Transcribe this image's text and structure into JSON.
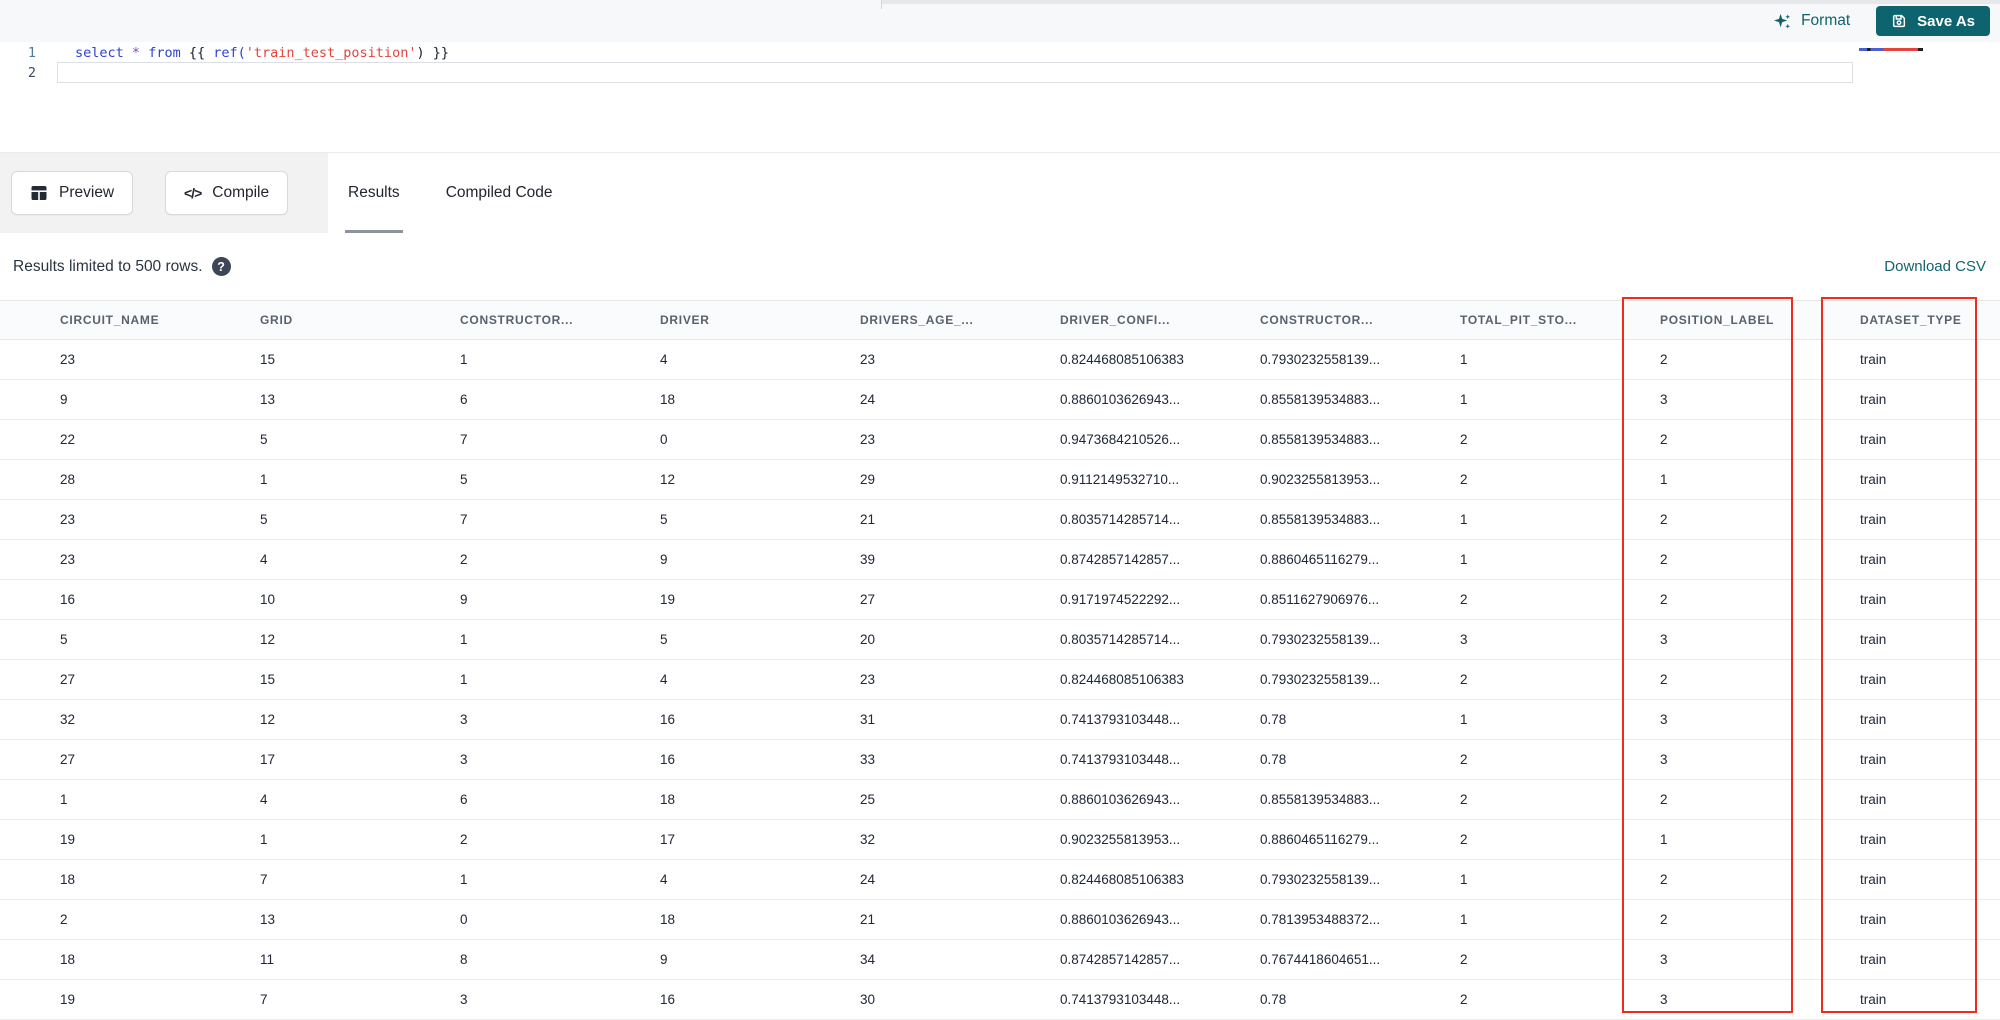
{
  "app": {
    "accent_teal": "#0e646e",
    "annotation_red": "#f02b1d"
  },
  "editor": {
    "format_label": "Format",
    "save_as_label": "Save As",
    "line_numbers": [
      "1",
      "2"
    ],
    "code_tokens": [
      {
        "t": "select",
        "c": "kw"
      },
      {
        "t": " ",
        "c": "pl"
      },
      {
        "t": "*",
        "c": "op"
      },
      {
        "t": " ",
        "c": "pl"
      },
      {
        "t": "from",
        "c": "kw"
      },
      {
        "t": " ",
        "c": "pl"
      },
      {
        "t": "{{ ",
        "c": "br"
      },
      {
        "t": "ref(",
        "c": "fn"
      },
      {
        "t": "'train_test_position'",
        "c": "str"
      },
      {
        "t": ")",
        "c": "br"
      },
      {
        "t": " }}",
        "c": "br"
      }
    ]
  },
  "toolbar": {
    "preview_label": "Preview",
    "compile_label": "Compile",
    "compile_glyph": "</>",
    "tabs": [
      {
        "label": "Results",
        "active": true
      },
      {
        "label": "Compiled Code",
        "active": false
      }
    ]
  },
  "results_bar": {
    "limit_text": "Results limited to 500 rows.",
    "help_glyph": "?",
    "download_label": "Download CSV"
  },
  "table": {
    "columns": [
      "CIRCUIT_NAME",
      "GRID",
      "CONSTRUCTOR...",
      "DRIVER",
      "DRIVERS_AGE_...",
      "DRIVER_CONFI...",
      "CONSTRUCTOR...",
      "TOTAL_PIT_STO...",
      "POSITION_LABEL",
      "DATASET_TYPE"
    ],
    "highlighted_columns": [
      "POSITION_LABEL",
      "DATASET_TYPE"
    ],
    "rows": [
      [
        "23",
        "15",
        "1",
        "4",
        "23",
        "0.824468085106383",
        "0.7930232558139...",
        "1",
        "2",
        "train"
      ],
      [
        "9",
        "13",
        "6",
        "18",
        "24",
        "0.8860103626943...",
        "0.8558139534883...",
        "1",
        "3",
        "train"
      ],
      [
        "22",
        "5",
        "7",
        "0",
        "23",
        "0.9473684210526...",
        "0.8558139534883...",
        "2",
        "2",
        "train"
      ],
      [
        "28",
        "1",
        "5",
        "12",
        "29",
        "0.9112149532710...",
        "0.9023255813953...",
        "2",
        "1",
        "train"
      ],
      [
        "23",
        "5",
        "7",
        "5",
        "21",
        "0.8035714285714...",
        "0.8558139534883...",
        "1",
        "2",
        "train"
      ],
      [
        "23",
        "4",
        "2",
        "9",
        "39",
        "0.8742857142857...",
        "0.8860465116279...",
        "1",
        "2",
        "train"
      ],
      [
        "16",
        "10",
        "9",
        "19",
        "27",
        "0.9171974522292...",
        "0.8511627906976...",
        "2",
        "2",
        "train"
      ],
      [
        "5",
        "12",
        "1",
        "5",
        "20",
        "0.8035714285714...",
        "0.7930232558139...",
        "3",
        "3",
        "train"
      ],
      [
        "27",
        "15",
        "1",
        "4",
        "23",
        "0.824468085106383",
        "0.7930232558139...",
        "2",
        "2",
        "train"
      ],
      [
        "32",
        "12",
        "3",
        "16",
        "31",
        "0.7413793103448...",
        "0.78",
        "1",
        "3",
        "train"
      ],
      [
        "27",
        "17",
        "3",
        "16",
        "33",
        "0.7413793103448...",
        "0.78",
        "2",
        "3",
        "train"
      ],
      [
        "1",
        "4",
        "6",
        "18",
        "25",
        "0.8860103626943...",
        "0.8558139534883...",
        "2",
        "2",
        "train"
      ],
      [
        "19",
        "1",
        "2",
        "17",
        "32",
        "0.9023255813953...",
        "0.8860465116279...",
        "2",
        "1",
        "train"
      ],
      [
        "18",
        "7",
        "1",
        "4",
        "24",
        "0.824468085106383",
        "0.7930232558139...",
        "1",
        "2",
        "train"
      ],
      [
        "2",
        "13",
        "0",
        "18",
        "21",
        "0.8860103626943...",
        "0.7813953488372...",
        "1",
        "2",
        "train"
      ],
      [
        "18",
        "11",
        "8",
        "9",
        "34",
        "0.8742857142857...",
        "0.7674418604651...",
        "2",
        "3",
        "train"
      ],
      [
        "19",
        "7",
        "3",
        "16",
        "30",
        "0.7413793103448...",
        "0.78",
        "2",
        "3",
        "train"
      ]
    ]
  }
}
